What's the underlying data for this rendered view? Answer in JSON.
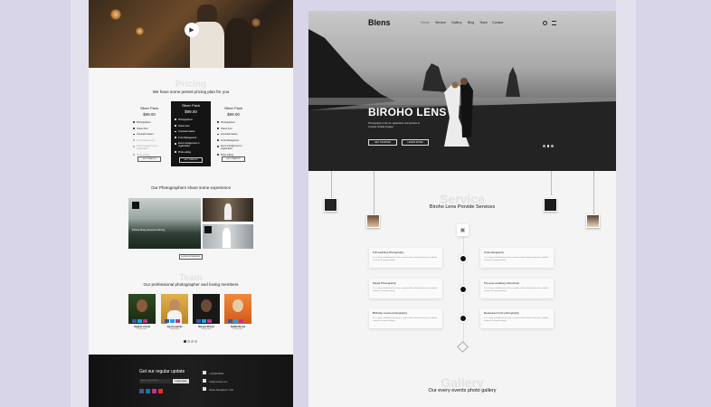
{
  "left_page": {
    "pricing": {
      "ghost": "Pricing",
      "subtitle": "We have some preset pricing plan for you",
      "plans": [
        {
          "name": "Silver Pack",
          "price": "$99.00",
          "features": [
            "Photographers",
            "Videos hour",
            "Cinematic feature",
            "Invite Management",
            "Event management or organization",
            "Photo editing"
          ],
          "button": "GET STARTED",
          "style": "light"
        },
        {
          "name": "Silver Pack",
          "price": "$99.00",
          "features": [
            "Photographers",
            "Videos hour",
            "Cinematic feature",
            "Invite Management",
            "Event management or organization",
            "Photo editing"
          ],
          "button": "GET STARTED",
          "style": "dark"
        },
        {
          "name": "Silver Pack",
          "price": "$99.00",
          "features": [
            "Photographers",
            "Videos hour",
            "Cinematic feature",
            "Invite Management",
            "Event management or organization",
            "Photo editing"
          ],
          "button": "GET STARTED",
          "style": "light"
        }
      ]
    },
    "experience": {
      "title": "Our Photographers share some experience",
      "caption": "Photos Sharp Mounted with fog",
      "button": "MORE EXPERIENCE"
    },
    "team": {
      "ghost": "Team",
      "title": "Our professional photographer and loving members",
      "members": [
        {
          "name": "Stephen Arnold",
          "role": "Photographer",
          "photo_color": "#2a3a1e"
        },
        {
          "name": "Jessica garden",
          "role": "Photographer",
          "photo_color": "#c99a2e"
        },
        {
          "name": "Maryam Elshed",
          "role": "Photographer",
          "photo_color": "#1b1b1b"
        },
        {
          "name": "Sebilla Nessie",
          "role": "Photographer",
          "photo_color": "#e3732a"
        }
      ]
    },
    "footer": {
      "title": "Get our regular update",
      "input_placeholder": "Enter email address",
      "subscribe": "SUBSCRIBE",
      "contacts": [
        "+12345678900",
        "info@example.com",
        "Dhaka, Bangladesh, USA"
      ]
    }
  },
  "right_page": {
    "brand": "Blens",
    "nav": [
      "Home",
      "Service",
      "Gallery",
      "Blog",
      "Team",
      "Contact"
    ],
    "hero": {
      "title": "BIROHO LENS",
      "text": "Photography is the art, application and practice of creating durable images",
      "btn_primary": "GET STARTED",
      "btn_secondary": "LEARN MORE"
    },
    "service": {
      "ghost": "Service",
      "title": "Biroho Lens Provide Services",
      "left": [
        {
          "title": "Full wedding Photography",
          "desc": "It is a long established fact that a reader will be distracted by the readable content of a page looking"
        },
        {
          "title": "Model Photography",
          "desc": "It is a long established fact that a reader will be distracted by the readable content of a page looking"
        },
        {
          "title": "Birthday events photography",
          "desc": "It is a long established fact that a reader will be distracted by the readable content of a page looking"
        }
      ],
      "right": [
        {
          "title": "Cinematography",
          "desc": "It is a long established fact that a reader will be distracted by the readable content of a page looking"
        },
        {
          "title": "Pre-post wedding photoshoot",
          "desc": "It is a long established fact that a reader will be distracted by the readable content of a page looking"
        },
        {
          "title": "Restaurant food photography",
          "desc": "It is a long established fact that a reader will be distracted by the readable content of a page looking"
        }
      ]
    },
    "gallery": {
      "ghost": "Gallery",
      "title": "Our every events photo gallery"
    }
  }
}
